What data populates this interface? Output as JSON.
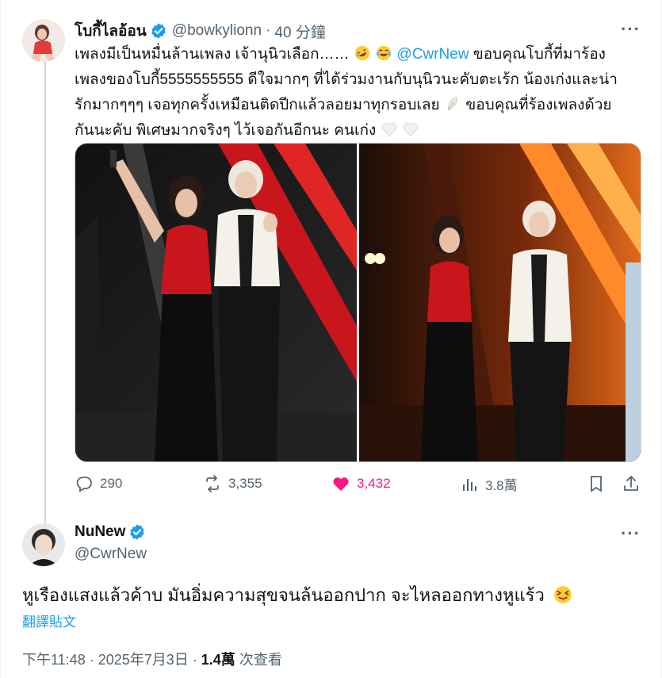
{
  "post": {
    "display_name": "โบกี้ไลอ้อน",
    "handle": "@bowkylionn",
    "time": "40 分鐘",
    "text_1": "เพลงมีเป็นหมื่นล้านเพลง เจ้านุนิวเลือก……",
    "mention": "@CwrNew",
    "text_2": " ขอบคุณโบกี้ที่มาร้อง",
    "text_line_2": "เพลงของโบกี้5555555555 ดีใจมากๆ ที่ได้ร่วมงานกับนุนิวนะคับตะเร้ก น้องเก่งและน่า",
    "text_line_3": "รักมากๆๆๆ เจอทุกครั้งเหมือนติดปีกแล้วลอยมาทุกรอบเลย",
    "text_line_3b": " ขอบคุณที่ร้องเพลงด้วย",
    "text_line_4": "กันนะคับ พิเศษมากจริงๆ ไว้เจอกันอีกนะ คนเก่ง",
    "emojis": [
      "rofl-emoji",
      "joy-emoji",
      "feather-emoji",
      "white-heart-emoji"
    ]
  },
  "actions": {
    "replies": "290",
    "reposts": "3,355",
    "likes": "3,432",
    "views": "3.8萬"
  },
  "reply": {
    "display_name": "NuNew",
    "handle": "@CwrNew",
    "text": "หูเรืองแสงแล้วค้าบ มันอิ่มความสุขจนล้นออกปาก จะไหลออกทางหูแร้ว",
    "translate_label": "翻譯貼文",
    "timestamp": "下午11:48 · 2025年7月3日",
    "separator": " · ",
    "views_count": "1.4萬",
    "views_label": " 次查看"
  },
  "colors": {
    "accent": "#1d9bf0",
    "like": "#f91880",
    "secondary_text": "#536471",
    "verified": "#1d9bf0"
  }
}
